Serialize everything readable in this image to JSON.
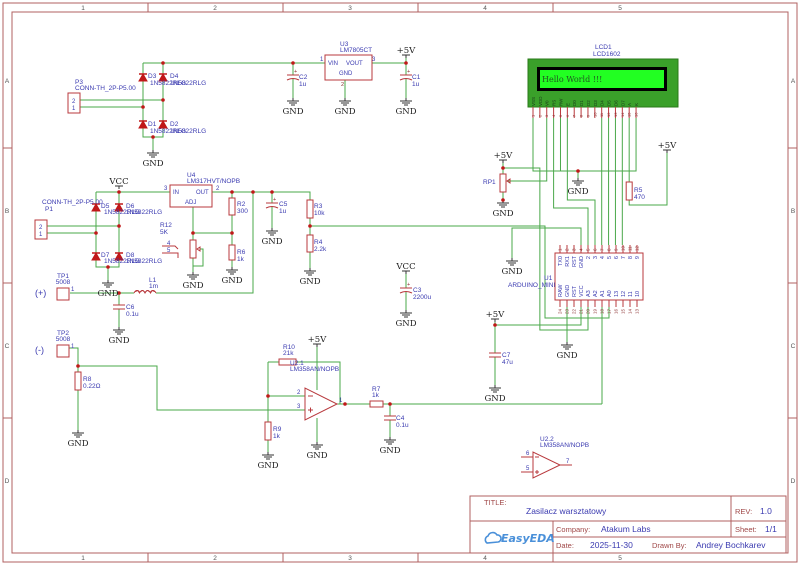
{
  "colors": {
    "wire": "#4aa84a",
    "part": "#b8383c",
    "label": "#3a3ab0",
    "lcd_body": "#3aa02a",
    "lcd_screen": "#22ff22"
  },
  "border": {
    "columns": [
      "1",
      "2",
      "3",
      "4",
      "5"
    ],
    "rows": [
      "A",
      "B",
      "C",
      "D"
    ]
  },
  "nets": {
    "vcc": "VCC",
    "plus5v": "+5V",
    "gnd": "GND",
    "pos": "(+)",
    "neg": "(-)"
  },
  "components": {
    "P3": {
      "ref": "P3",
      "value": "CONN-TH_2P-P5.00",
      "pins": [
        "2",
        "1"
      ]
    },
    "D1": {
      "ref": "D1",
      "value": "1N5822RLG"
    },
    "D2": {
      "ref": "D2",
      "value": "1N5822RLG"
    },
    "D3": {
      "ref": "D3",
      "value": "1N5822RLG"
    },
    "D4": {
      "ref": "D4",
      "value": "1N5822RLG"
    },
    "U3": {
      "ref": "U3",
      "value": "LM7805CT",
      "pin_in": "VIN",
      "pin_out": "VOUT",
      "pin_gnd": "GND",
      "num_in": "1",
      "num_out": "3",
      "num_gnd": "2"
    },
    "C1": {
      "ref": "C1",
      "value": "1u"
    },
    "C2": {
      "ref": "C2",
      "value": "1u"
    },
    "RP1": {
      "ref": "RP1"
    },
    "R5": {
      "ref": "R5",
      "value": "470"
    },
    "P1": {
      "ref": "P1",
      "value": "CONN-TH_2P-P5.00",
      "pins": [
        "2",
        "1"
      ]
    },
    "D5": {
      "ref": "D5",
      "value": "1N5822RLG"
    },
    "D6": {
      "ref": "D6",
      "value": "1N5822RLG"
    },
    "D7": {
      "ref": "D7",
      "value": "1N5822RLG"
    },
    "D8": {
      "ref": "D8",
      "value": "1N5822RLG"
    },
    "U4": {
      "ref": "U4",
      "value": "LM317HVT/NOPB",
      "pin_in": "IN",
      "pin_out": "OUT",
      "pin_adj": "ADJ",
      "num_in": "3",
      "num_out": "2"
    },
    "R12": {
      "ref": "R12",
      "value": "5K",
      "pins": [
        "4",
        "5"
      ]
    },
    "R2": {
      "ref": "R2",
      "value": "300"
    },
    "R6": {
      "ref": "R6",
      "value": "1k"
    },
    "C5": {
      "ref": "C5",
      "value": "1u"
    },
    "R3": {
      "ref": "R3",
      "value": "10k"
    },
    "R4": {
      "ref": "R4",
      "value": "2.2k"
    },
    "TP1": {
      "ref": "TP1",
      "value": "5008",
      "pin": "1"
    },
    "L1": {
      "ref": "L1",
      "value": "1m"
    },
    "C6": {
      "ref": "C6",
      "value": "0.1u"
    },
    "C3": {
      "ref": "C3",
      "value": "2200u"
    },
    "TP2": {
      "ref": "TP2",
      "value": "5008",
      "pin": "1"
    },
    "R8": {
      "ref": "R8",
      "value": "0.22Ω"
    },
    "R10": {
      "ref": "R10",
      "value": "21k"
    },
    "U2_1": {
      "ref": "U2.1",
      "value": "LM358AN/NOPB",
      "pin_inv": "2",
      "pin_noninv": "3",
      "pin_out": "1"
    },
    "R9": {
      "ref": "R9",
      "value": "1k"
    },
    "R7": {
      "ref": "R7",
      "value": "1k"
    },
    "C4": {
      "ref": "C4",
      "value": "0.1u"
    },
    "C7": {
      "ref": "C7",
      "value": "47u"
    },
    "U2_2": {
      "ref": "U2.2",
      "value": "LM358AN/NOPB",
      "pin_inv": "6",
      "pin_noninv": "5",
      "pin_out": "7"
    }
  },
  "lcd": {
    "ref": "LCD1",
    "value": "LCD1602",
    "display_text": "Hello World !!!",
    "pin_labels": [
      "VSS",
      "VDD",
      "V0",
      "RS",
      "RW",
      "E",
      "D0",
      "D1",
      "D2",
      "D3",
      "D4",
      "D5",
      "D6",
      "D7",
      "A",
      "K"
    ],
    "pin_numbers": [
      "1",
      "2",
      "3",
      "4",
      "5",
      "6",
      "7",
      "8",
      "9",
      "10",
      "11",
      "12",
      "13",
      "14",
      "15",
      "16"
    ]
  },
  "arduino": {
    "ref": "U1",
    "value": "ARDUINO_MINI",
    "top_labels": [
      "TX0",
      "RX1",
      "RST",
      "GND",
      "2",
      "3",
      "4",
      "5",
      "6",
      "7",
      "8",
      "9"
    ],
    "top_numbers": [
      "1",
      "2",
      "3",
      "4",
      "5",
      "6",
      "7",
      "8",
      "9",
      "10",
      "11",
      "12"
    ],
    "bottom_labels": [
      "RAW",
      "GND",
      "RST",
      "VCC",
      "A3",
      "A2",
      "A1",
      "A0",
      "13",
      "12",
      "11",
      "10"
    ],
    "bottom_numbers": [
      "24",
      "23",
      "22",
      "21",
      "20",
      "19",
      "18",
      "17",
      "16",
      "15",
      "14",
      "13"
    ]
  },
  "title_block": {
    "title_label": "TITLE:",
    "title": "Zasilacz warsztatowy",
    "rev_label": "REV:",
    "rev": "1.0",
    "company_label": "Company:",
    "company": "Atakum Labs",
    "sheet_label": "Sheet:",
    "sheet": "1/1",
    "date_label": "Date:",
    "date": "2025-11-30",
    "drawn_label": "Drawn By:",
    "drawn_by": "Andrey Bochkarev",
    "logo": "EasyEDA"
  }
}
